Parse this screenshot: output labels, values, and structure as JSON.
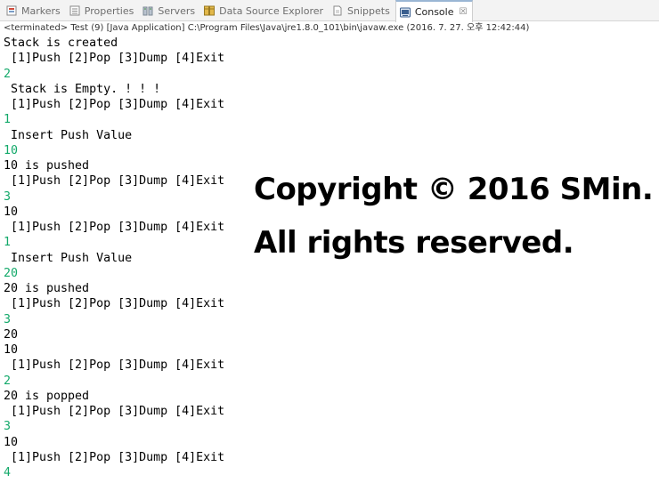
{
  "tabs": [
    {
      "label": "Markers",
      "icon": "markers-icon",
      "active": false
    },
    {
      "label": "Properties",
      "icon": "properties-icon",
      "active": false
    },
    {
      "label": "Servers",
      "icon": "servers-icon",
      "active": false
    },
    {
      "label": "Data Source Explorer",
      "icon": "data-source-explorer-icon",
      "active": false
    },
    {
      "label": "Snippets",
      "icon": "snippets-icon",
      "active": false
    },
    {
      "label": "Console",
      "icon": "console-icon",
      "active": true,
      "close": "☒"
    }
  ],
  "status_line": "<terminated> Test (9) [Java Application] C:\\Program Files\\Java\\jre1.8.0_101\\bin\\javaw.exe (2016. 7. 27. 오후 12:42:44)",
  "console_lines": [
    {
      "text": "Stack is created",
      "kind": "output"
    },
    {
      "text": " [1]Push [2]Pop [3]Dump [4]Exit",
      "kind": "output"
    },
    {
      "text": "2",
      "kind": "input"
    },
    {
      "text": " Stack is Empty. ! ! !",
      "kind": "output"
    },
    {
      "text": " [1]Push [2]Pop [3]Dump [4]Exit",
      "kind": "output"
    },
    {
      "text": "1",
      "kind": "input"
    },
    {
      "text": " Insert Push Value",
      "kind": "output"
    },
    {
      "text": "10",
      "kind": "input"
    },
    {
      "text": "10 is pushed",
      "kind": "output"
    },
    {
      "text": " [1]Push [2]Pop [3]Dump [4]Exit",
      "kind": "output"
    },
    {
      "text": "3",
      "kind": "input"
    },
    {
      "text": "10",
      "kind": "output"
    },
    {
      "text": " [1]Push [2]Pop [3]Dump [4]Exit",
      "kind": "output"
    },
    {
      "text": "1",
      "kind": "input"
    },
    {
      "text": " Insert Push Value",
      "kind": "output"
    },
    {
      "text": "20",
      "kind": "input"
    },
    {
      "text": "20 is pushed",
      "kind": "output"
    },
    {
      "text": " [1]Push [2]Pop [3]Dump [4]Exit",
      "kind": "output"
    },
    {
      "text": "3",
      "kind": "input"
    },
    {
      "text": "20",
      "kind": "output"
    },
    {
      "text": "10",
      "kind": "output"
    },
    {
      "text": " [1]Push [2]Pop [3]Dump [4]Exit",
      "kind": "output"
    },
    {
      "text": "2",
      "kind": "input"
    },
    {
      "text": "20 is popped",
      "kind": "output"
    },
    {
      "text": " [1]Push [2]Pop [3]Dump [4]Exit",
      "kind": "output"
    },
    {
      "text": "3",
      "kind": "input"
    },
    {
      "text": "10",
      "kind": "output"
    },
    {
      "text": " [1]Push [2]Pop [3]Dump [4]Exit",
      "kind": "output"
    },
    {
      "text": "4",
      "kind": "input"
    }
  ],
  "watermark": {
    "line1": "Copyright © 2016 SMin.",
    "line2": "All rights reserved."
  },
  "colors": {
    "input_text": "#13a96a",
    "output_text": "#000000"
  }
}
